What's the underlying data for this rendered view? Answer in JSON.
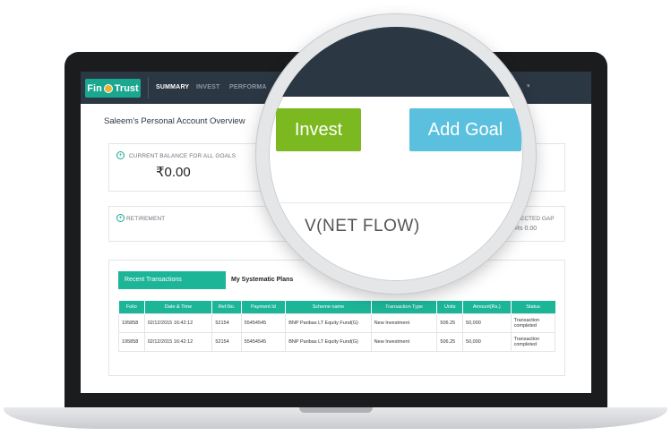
{
  "logo": {
    "text_left": "Fin",
    "text_right": "Trust"
  },
  "nav": {
    "items": [
      {
        "label": "SUMMARY",
        "active": true
      },
      {
        "label": "INVEST",
        "active": false
      },
      {
        "label": "PERFORMA",
        "active": false
      }
    ]
  },
  "page": {
    "title": "Saleem's Personal Account Overview"
  },
  "balance_card": {
    "label": "CURRENT BALANCE FOR ALL GOALS",
    "value": "₹0.00"
  },
  "retirement_card": {
    "label": "RETIREMENT",
    "gap_label": "ROJECTED GAP",
    "gap_value": "Rs 0.00"
  },
  "magnifier": {
    "invest_button": "Invest",
    "add_goal_button": "Add Goal",
    "net_flow_text": "V(NET FLOW)"
  },
  "tabs": {
    "recent_transactions": "Recent Transactions",
    "systematic_plans": "My Systematic Plans"
  },
  "table": {
    "headers": [
      "Folio",
      "Date & Time",
      "Ref.No.",
      "Payment Id",
      "Scheme name",
      "Transaction Type",
      "Units",
      "Amount(Rs.)",
      "Status"
    ],
    "rows": [
      [
        "195858",
        "02/12/2015 16:42:12",
        "52154",
        "55454545",
        "BNP Paribas LT Equity Fund(G)",
        "New Investment",
        "506.25",
        "50,000",
        "Transaction completed"
      ],
      [
        "195858",
        "02/12/2015 16:42:12",
        "52154",
        "55454545",
        "BNP Paribas LT Equity Fund(G)",
        "New Investment",
        "506.25",
        "50,000",
        "Transaction completed"
      ]
    ]
  },
  "colors": {
    "nav_bg": "#2b3743",
    "accent_teal": "#1db598",
    "invest_green": "#7cb81f",
    "add_goal_blue": "#5bc0de"
  }
}
